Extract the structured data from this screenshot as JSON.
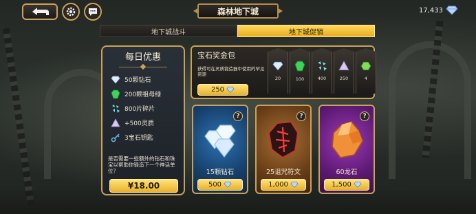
{
  "header": {
    "title": "森林地下城",
    "currency_amount": "17,433"
  },
  "tabs": [
    {
      "label": "地下城战斗",
      "active": false
    },
    {
      "label": "地下城促销",
      "active": true
    }
  ],
  "daily_offer": {
    "title": "每日优惠",
    "items": [
      {
        "icon": "diamond-icon",
        "label": "50颗钻石"
      },
      {
        "icon": "emerald-icon",
        "label": "200颗祖母绿"
      },
      {
        "icon": "shards-icon",
        "label": "800片碎片"
      },
      {
        "icon": "spirit-crystal-icon",
        "label": "+500灵质"
      },
      {
        "icon": "key-icon",
        "label": "3宝石钥匙"
      }
    ],
    "description": "是否需要一些额外的钻石和珠宝以帮助你锻造下一个神话单位？",
    "price": "¥18.00"
  },
  "gem_bundle": {
    "title": "宝石奖金包",
    "description": "获得可在灵质锻造器中使用的罕见资源",
    "price": "250",
    "slots": [
      {
        "icon": "diamond-icon",
        "count": "20"
      },
      {
        "icon": "emerald-icon",
        "count": "100"
      },
      {
        "icon": "shards-icon",
        "count": "400"
      },
      {
        "icon": "spirit-crystal-icon",
        "count": "250"
      },
      {
        "icon": "green-gem-icon",
        "count": "4"
      }
    ]
  },
  "cards": [
    {
      "label": "15颗钻石",
      "price": "500",
      "art": "diamond-pile-icon"
    },
    {
      "label": "25诅咒符文",
      "price": "1,000",
      "art": "cursed-rune-icon"
    },
    {
      "label": "60龙石",
      "price": "1,500",
      "art": "dragon-stone-icon"
    }
  ],
  "colors": {
    "gold": "#c9a25a",
    "button_gold": "#e9b12c",
    "tab_active": "#ffd85a"
  }
}
